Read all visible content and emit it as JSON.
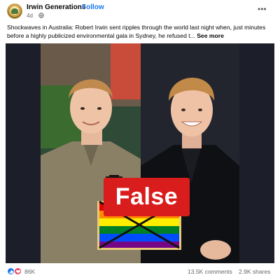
{
  "post": {
    "page_name": "Irwin Generations",
    "separator": "·",
    "follow_label": "Follow",
    "time": "4d",
    "privacy_icon": "globe-icon",
    "more_icon": "more-options-icon",
    "text": "Shockwaves in Australia: Robert Irwin sent ripples through the world last night when, just minutes before a highly publicized environmental gala in Sydney, he refused t...",
    "see_more_label": "See more"
  },
  "media": {
    "badge_label": "False",
    "badge_color": "#d91c1c",
    "flag_colors": [
      "#e40303",
      "#ff8c00",
      "#ffed00",
      "#008026",
      "#004dff",
      "#750787"
    ],
    "background": "#1c1f29"
  },
  "footer": {
    "reaction_icons": [
      "like-icon",
      "heart-icon"
    ],
    "reactions_count": "86K",
    "comments_count": "13.5K comments",
    "shares_count": "2.9K shares"
  }
}
